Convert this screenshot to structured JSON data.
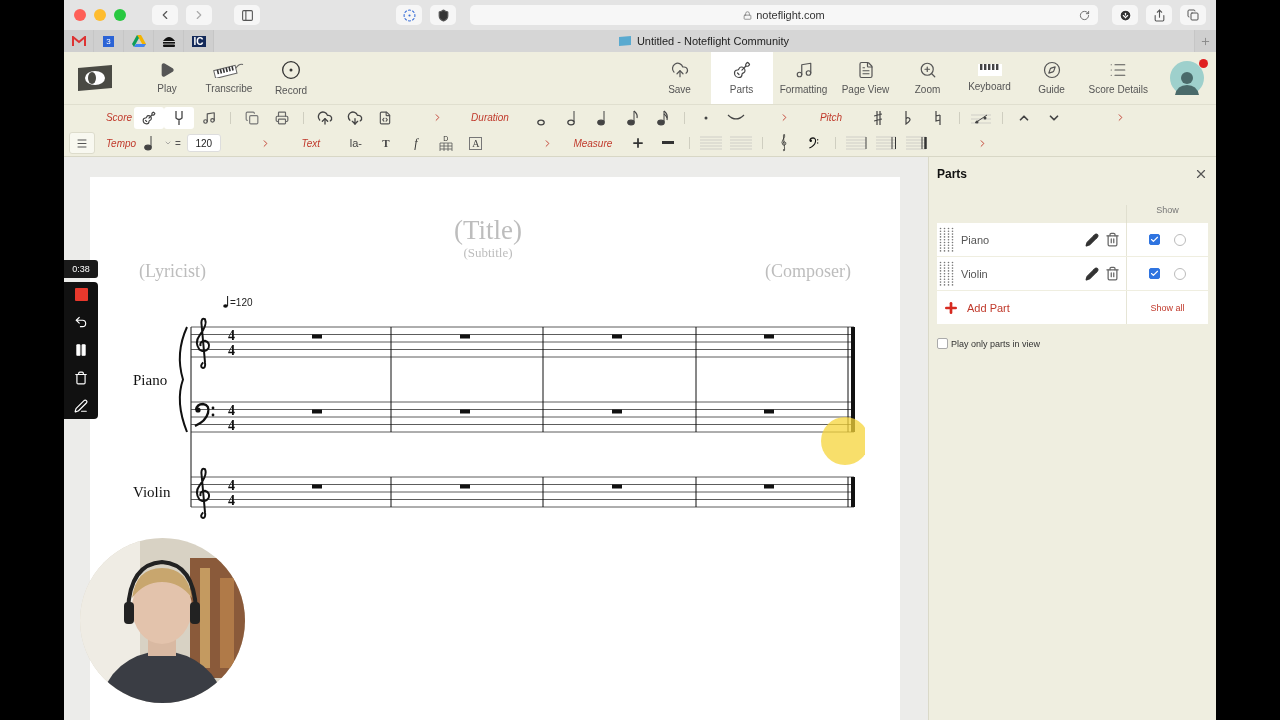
{
  "browser": {
    "url": "noteflight.com",
    "tab_title": "Untitled - Noteflight Community",
    "bookmarks": [
      {
        "kind": "mail"
      },
      {
        "kind": "calendar",
        "label": "3"
      },
      {
        "kind": "drive"
      },
      {
        "kind": "burger"
      },
      {
        "kind": "text",
        "label": "IC"
      }
    ]
  },
  "toolbar": {
    "left": [
      {
        "kind": "play",
        "label": "Play"
      },
      {
        "kind": "transcribe",
        "label": "Transcribe"
      },
      {
        "kind": "record",
        "label": "Record"
      }
    ],
    "right": [
      {
        "kind": "save",
        "label": "Save",
        "selected": false
      },
      {
        "kind": "parts",
        "label": "Parts",
        "selected": true
      },
      {
        "kind": "formatting",
        "label": "Formatting",
        "selected": false
      },
      {
        "kind": "page-view",
        "label": "Page View",
        "selected": false
      },
      {
        "kind": "zoom",
        "label": "Zoom",
        "selected": false
      },
      {
        "kind": "keyboard",
        "label": "Keyboard",
        "selected": false
      },
      {
        "kind": "guide",
        "label": "Guide",
        "selected": false
      },
      {
        "kind": "details",
        "label": "Score Details",
        "selected": false
      }
    ]
  },
  "ribbon": {
    "score_label": "Score",
    "score_tools": [
      {
        "kind": "guitar",
        "selected": true
      },
      {
        "kind": "fork",
        "selected": true
      },
      {
        "kind": "sheet",
        "selected": false
      }
    ],
    "duration_label": "Duration",
    "pitch_label": "Pitch",
    "tempo_label": "Tempo",
    "equals": "=",
    "tempo_value": "120",
    "text_label": "Text",
    "text_tools": [
      "la-",
      "T",
      "f"
    ],
    "chord_letter": "D",
    "box_letter": "A",
    "measure_label": "Measure"
  },
  "recorder": {
    "time": "0:38"
  },
  "score": {
    "title": "(Title)",
    "subtitle": "(Subtitle)",
    "lyricist": "(Lyricist)",
    "composer": "(Composer)",
    "tempo": "=120",
    "instruments": [
      {
        "name": "Piano",
        "staves": [
          {
            "kind": "treble",
            "time_signature": [
              "4",
              "4"
            ]
          },
          {
            "kind": "bass",
            "time_signature": [
              "4",
              "4"
            ]
          }
        ]
      },
      {
        "name": "Violin",
        "staves": [
          {
            "kind": "treble",
            "time_signature": [
              "4",
              "4"
            ]
          }
        ]
      }
    ],
    "measures": [
      {
        "kind": "rest"
      },
      {
        "kind": "rest"
      },
      {
        "kind": "rest"
      },
      {
        "kind": "rest"
      }
    ]
  },
  "parts_panel": {
    "title": "Parts",
    "show_header": "Show",
    "parts": [
      {
        "name": "Piano",
        "shown": true,
        "solo": false
      },
      {
        "name": "Violin",
        "shown": true,
        "solo": false
      }
    ],
    "add_label": "Add Part",
    "show_all": "Show all",
    "play_only": {
      "label": "Play only parts in view",
      "checked": false
    }
  }
}
